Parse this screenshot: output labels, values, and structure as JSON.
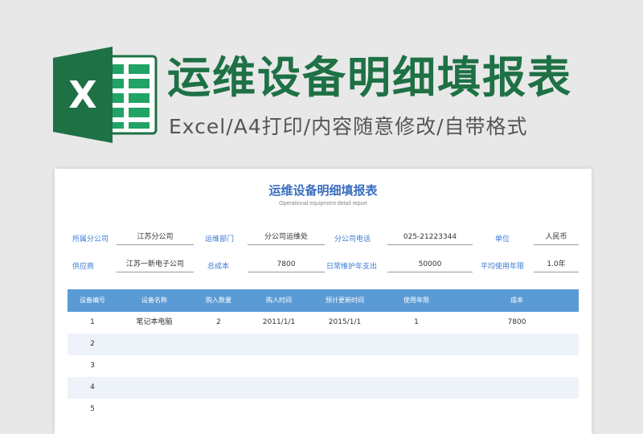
{
  "banner": {
    "headline": "运维设备明细填报表",
    "subline": "Excel/A4打印/内容随意修改/自带格式",
    "logo_icon": "excel-logo-icon",
    "colors": {
      "excel_green": "#1e7145",
      "excel_dark": "#185c37",
      "grid_green": "#21a366"
    }
  },
  "sheet": {
    "title": "运维设备明细填报表",
    "subtitle": "Operational equipment detail report",
    "info_row1": [
      {
        "label": "所属分公司",
        "value": "江苏分公司"
      },
      {
        "label": "运维部门",
        "value": "分公司运维处"
      },
      {
        "label": "分公司电话",
        "value": "025-21223344"
      },
      {
        "label": "单位",
        "value": "人民币"
      }
    ],
    "info_row2": [
      {
        "label": "供应商",
        "value": "江苏一新电子公司"
      },
      {
        "label": "总成本",
        "value": "7800"
      },
      {
        "label": "日常维护年支出",
        "value": "50000"
      },
      {
        "label": "平均使用年限",
        "value": "1.0年"
      }
    ],
    "table": {
      "headers": [
        "设备编号",
        "设备名称",
        "购入数量",
        "购入时间",
        "预计更新时间",
        "使用年限",
        "成本"
      ],
      "rows": [
        [
          "1",
          "笔记本电脑",
          "2",
          "2011/1/1",
          "2015/1/1",
          "1",
          "7800"
        ],
        [
          "2",
          "",
          "",
          "",
          "",
          "",
          ""
        ],
        [
          "3",
          "",
          "",
          "",
          "",
          "",
          ""
        ],
        [
          "4",
          "",
          "",
          "",
          "",
          "",
          ""
        ],
        [
          "5",
          "",
          "",
          "",
          "",
          "",
          ""
        ]
      ]
    },
    "colors": {
      "header_bg": "#5b9bd5",
      "label_blue": "#3a7bd5",
      "title_blue": "#3a6fc0",
      "stripe": "#eef2f9"
    }
  }
}
